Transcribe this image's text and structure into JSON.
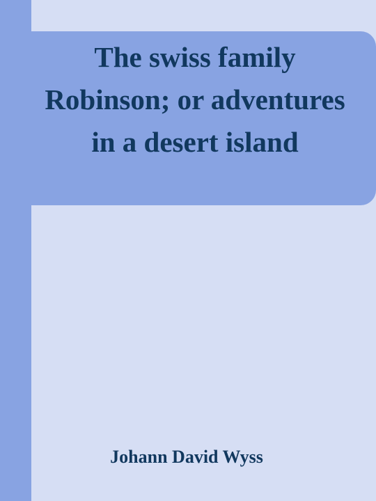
{
  "book": {
    "title": "The swiss family Robinson; or adventures in a desert island",
    "author": "Johann David Wyss"
  },
  "colors": {
    "background": "#d6def4",
    "accent": "#88a3e2",
    "text": "#11385e"
  }
}
